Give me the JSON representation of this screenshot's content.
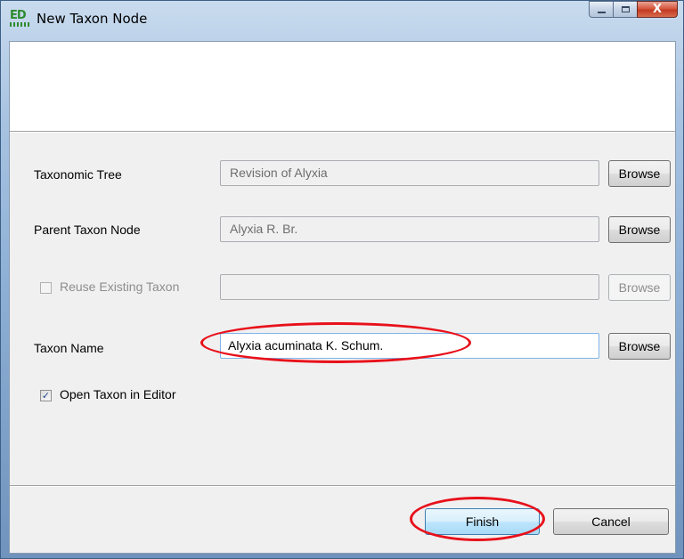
{
  "window": {
    "title": "New Taxon Node",
    "app_icon": "taxonomic-editor-icon",
    "app_icon_text": "ED",
    "close_glyph": "X"
  },
  "form": {
    "taxonomic_tree": {
      "label": "Taxonomic Tree",
      "value": "Revision of Alyxia",
      "browse": "Browse"
    },
    "parent_taxon_node": {
      "label": "Parent Taxon Node",
      "value": "Alyxia R. Br.",
      "browse": "Browse"
    },
    "reuse_existing_taxon": {
      "label": "Reuse Existing Taxon",
      "checked": false,
      "value": "",
      "browse": "Browse"
    },
    "taxon_name": {
      "label": "Taxon Name",
      "value": "Alyxia acuminata K. Schum.",
      "browse": "Browse"
    },
    "open_in_editor": {
      "label": "Open Taxon in Editor",
      "checked": true,
      "check_glyph": "✓"
    }
  },
  "footer": {
    "finish": "Finish",
    "cancel": "Cancel"
  },
  "colors": {
    "annotation": "#e8101a",
    "title_bar": "#a9c4e2"
  }
}
